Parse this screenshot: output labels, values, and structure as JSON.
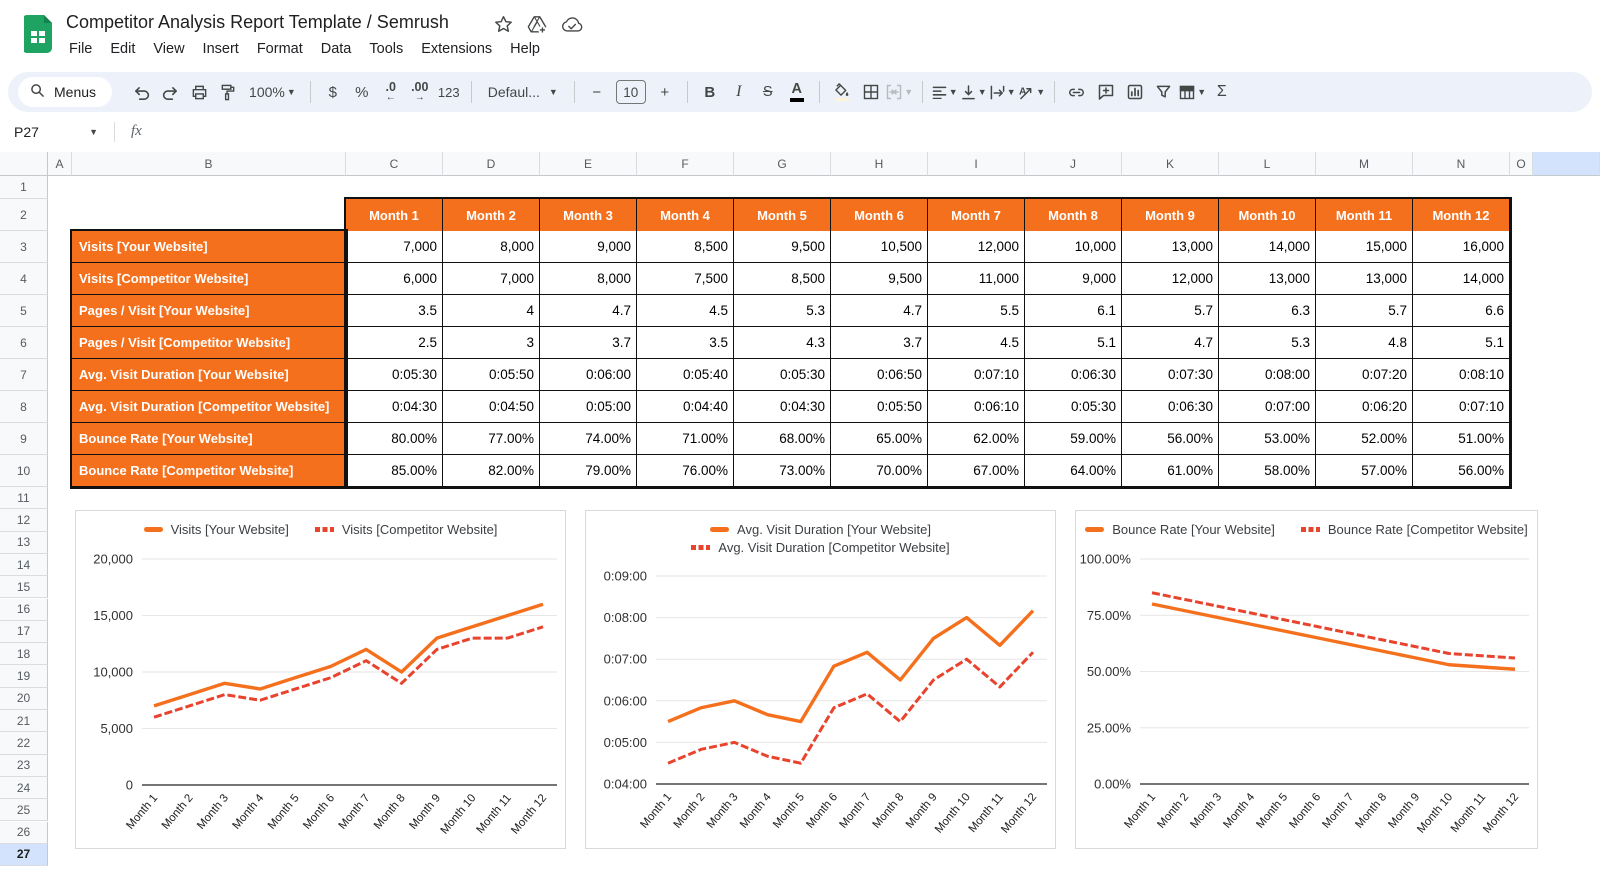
{
  "colors": {
    "orange": "#F4701D",
    "red": "#E8432D",
    "selection_blue": "#D3E3FD",
    "toolbar_bg": "#EDF2FA",
    "logo_green": "#1EA362"
  },
  "header": {
    "title": "Competitor Analysis Report Template / Semrush",
    "menus": [
      "File",
      "Edit",
      "View",
      "Insert",
      "Format",
      "Data",
      "Tools",
      "Extensions",
      "Help"
    ]
  },
  "toolbar": {
    "search_label": "Menus",
    "zoom_value": "100%",
    "currency": "$",
    "percent": "%",
    "dec_decrease": ".0",
    "dec_increase": ".00",
    "format_123": "123",
    "font_family_value": "Defaul...",
    "minus": "−",
    "font_size_value": "10",
    "plus": "+",
    "bold": "B",
    "italic": "I",
    "strikethrough": "S",
    "text_color": "A",
    "sigma": "Σ"
  },
  "formula_bar": {
    "cell_reference": "P27",
    "fx_label": "fx"
  },
  "grid": {
    "columns": [
      "A",
      "B",
      "C",
      "D",
      "E",
      "F",
      "G",
      "H",
      "I",
      "J",
      "K",
      "L",
      "M",
      "N",
      "O"
    ],
    "rows": [
      "1",
      "2",
      "3",
      "4",
      "5",
      "6",
      "7",
      "8",
      "9",
      "10",
      "11",
      "12",
      "13",
      "14",
      "15",
      "16",
      "17",
      "18",
      "19",
      "20",
      "21",
      "22",
      "23",
      "24",
      "25",
      "26",
      "27"
    ],
    "selected_row": "27",
    "selected_cell": "P27"
  },
  "table": {
    "months": [
      "Month 1",
      "Month 2",
      "Month 3",
      "Month 4",
      "Month 5",
      "Month 6",
      "Month 7",
      "Month 8",
      "Month 9",
      "Month 10",
      "Month 11",
      "Month 12"
    ],
    "rows": [
      {
        "label": "Visits [Your Website]",
        "values": [
          "7,000",
          "8,000",
          "9,000",
          "8,500",
          "9,500",
          "10,500",
          "12,000",
          "10,000",
          "13,000",
          "14,000",
          "15,000",
          "16,000"
        ]
      },
      {
        "label": "Visits [Competitor Website]",
        "values": [
          "6,000",
          "7,000",
          "8,000",
          "7,500",
          "8,500",
          "9,500",
          "11,000",
          "9,000",
          "12,000",
          "13,000",
          "13,000",
          "14,000"
        ]
      },
      {
        "label": "Pages / Visit [Your Website]",
        "values": [
          "3.5",
          "4",
          "4.7",
          "4.5",
          "5.3",
          "4.7",
          "5.5",
          "6.1",
          "5.7",
          "6.3",
          "5.7",
          "6.6"
        ]
      },
      {
        "label": "Pages / Visit [Competitor Website]",
        "values": [
          "2.5",
          "3",
          "3.7",
          "3.5",
          "4.3",
          "3.7",
          "4.5",
          "5.1",
          "4.7",
          "5.3",
          "4.8",
          "5.1"
        ]
      },
      {
        "label": "Avg. Visit Duration [Your Website]",
        "values": [
          "0:05:30",
          "0:05:50",
          "0:06:00",
          "0:05:40",
          "0:05:30",
          "0:06:50",
          "0:07:10",
          "0:06:30",
          "0:07:30",
          "0:08:00",
          "0:07:20",
          "0:08:10"
        ]
      },
      {
        "label": "Avg. Visit Duration [Competitor Website]",
        "values": [
          "0:04:30",
          "0:04:50",
          "0:05:00",
          "0:04:40",
          "0:04:30",
          "0:05:50",
          "0:06:10",
          "0:05:30",
          "0:06:30",
          "0:07:00",
          "0:06:20",
          "0:07:10"
        ]
      },
      {
        "label": "Bounce Rate [Your Website]",
        "values": [
          "80.00%",
          "77.00%",
          "74.00%",
          "71.00%",
          "68.00%",
          "65.00%",
          "62.00%",
          "59.00%",
          "56.00%",
          "53.00%",
          "52.00%",
          "51.00%"
        ]
      },
      {
        "label": "Bounce Rate [Competitor Website]",
        "values": [
          "85.00%",
          "82.00%",
          "79.00%",
          "76.00%",
          "73.00%",
          "70.00%",
          "67.00%",
          "64.00%",
          "61.00%",
          "58.00%",
          "57.00%",
          "56.00%"
        ]
      }
    ]
  },
  "chart_data": [
    {
      "id": "visits",
      "type": "line",
      "categories": [
        "Month 1",
        "Month 2",
        "Month 3",
        "Month 4",
        "Month 5",
        "Month 6",
        "Month 7",
        "Month 8",
        "Month 9",
        "Month 10",
        "Month 11",
        "Month 12"
      ],
      "series": [
        {
          "name": "Visits [Your Website]",
          "color": "orange",
          "style": "solid",
          "values": [
            7000,
            8000,
            9000,
            8500,
            9500,
            10500,
            12000,
            10000,
            13000,
            14000,
            15000,
            16000
          ]
        },
        {
          "name": "Visits [Competitor Website]",
          "color": "red",
          "style": "dashed",
          "values": [
            6000,
            7000,
            8000,
            7500,
            8500,
            9500,
            11000,
            9000,
            12000,
            13000,
            13000,
            14000
          ]
        }
      ],
      "ylim": [
        0,
        20000
      ],
      "yticks": [
        {
          "label": "0",
          "value": 0
        },
        {
          "label": "5,000",
          "value": 5000
        },
        {
          "label": "10,000",
          "value": 10000
        },
        {
          "label": "15,000",
          "value": 15000
        },
        {
          "label": "20,000",
          "value": 20000
        }
      ],
      "legend_rows": 1,
      "legend_position": "top",
      "grid": true
    },
    {
      "id": "avg-visit-duration",
      "type": "line",
      "categories": [
        "Month 1",
        "Month 2",
        "Month 3",
        "Month 4",
        "Month 5",
        "Month 6",
        "Month 7",
        "Month 8",
        "Month 9",
        "Month 10",
        "Month 11",
        "Month 12"
      ],
      "series": [
        {
          "name": "Avg. Visit Duration [Your Website]",
          "color": "orange",
          "style": "solid",
          "values": [
            330,
            350,
            360,
            340,
            330,
            410,
            430,
            390,
            450,
            480,
            440,
            490
          ]
        },
        {
          "name": "Avg. Visit Duration [Competitor Website]",
          "color": "red",
          "style": "dashed",
          "values": [
            270,
            290,
            300,
            280,
            270,
            350,
            370,
            330,
            390,
            420,
            380,
            430
          ]
        }
      ],
      "ylim": [
        240,
        540
      ],
      "yticks": [
        {
          "label": "0:04:00",
          "value": 240
        },
        {
          "label": "0:05:00",
          "value": 300
        },
        {
          "label": "0:06:00",
          "value": 360
        },
        {
          "label": "0:07:00",
          "value": 420
        },
        {
          "label": "0:08:00",
          "value": 480
        },
        {
          "label": "0:09:00",
          "value": 540
        }
      ],
      "legend_rows": 2,
      "legend_position": "top",
      "grid": true
    },
    {
      "id": "bounce-rate",
      "type": "line",
      "categories": [
        "Month 1",
        "Month 2",
        "Month 3",
        "Month 4",
        "Month 5",
        "Month 6",
        "Month 7",
        "Month 8",
        "Month 9",
        "Month 10",
        "Month 11",
        "Month 12"
      ],
      "series": [
        {
          "name": "Bounce Rate [Your Website]",
          "color": "orange",
          "style": "solid",
          "values": [
            80,
            77,
            74,
            71,
            68,
            65,
            62,
            59,
            56,
            53,
            52,
            51
          ]
        },
        {
          "name": "Bounce Rate [Competitor Website]",
          "color": "red",
          "style": "dashed",
          "values": [
            85,
            82,
            79,
            76,
            73,
            70,
            67,
            64,
            61,
            58,
            57,
            56
          ]
        }
      ],
      "ylim": [
        0,
        100
      ],
      "yticks": [
        {
          "label": "0.00%",
          "value": 0
        },
        {
          "label": "25.00%",
          "value": 25
        },
        {
          "label": "50.00%",
          "value": 50
        },
        {
          "label": "75.00%",
          "value": 75
        },
        {
          "label": "100.00%",
          "value": 100
        }
      ],
      "legend_rows": 1,
      "legend_position": "top",
      "grid": true
    }
  ]
}
